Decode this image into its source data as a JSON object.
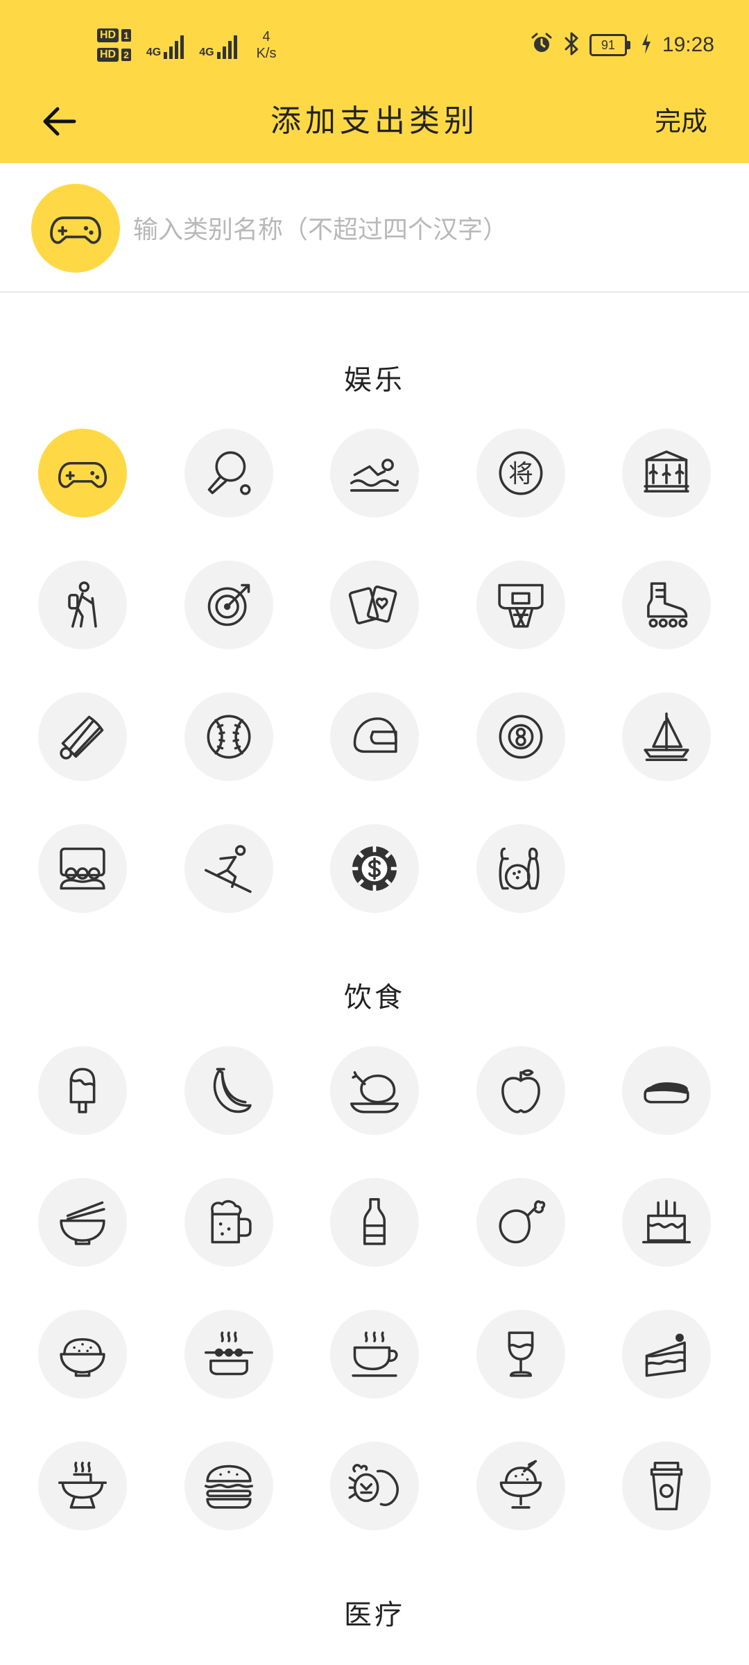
{
  "status_bar": {
    "sim1_badge": "HD",
    "sim1_slot": "1",
    "sim2_badge": "HD",
    "sim2_slot": "2",
    "net1": "4G",
    "net2": "4G",
    "speed_value": "4",
    "speed_unit": "K/s",
    "battery": "91",
    "time": "19:28"
  },
  "header": {
    "title": "添加支出类别",
    "done": "完成"
  },
  "input": {
    "placeholder": "输入类别名称（不超过四个汉字）",
    "value": "",
    "selected_icon": "gamepad-icon"
  },
  "sections": [
    {
      "title": "娱乐",
      "icons": [
        "gamepad-icon",
        "ping-pong-icon",
        "swimming-icon",
        "chess-piece-icon",
        "carousel-icon",
        "hiking-icon",
        "target-icon",
        "playing-cards-icon",
        "basketball-hoop-icon",
        "roller-skate-icon",
        "shuttlecock-icon",
        "baseball-icon",
        "helmet-icon",
        "billiard-ball-icon",
        "sailboat-icon",
        "cinema-icon",
        "skiing-icon",
        "poker-chip-icon",
        "bowling-icon"
      ],
      "chess_glyph": "将"
    },
    {
      "title": "饮食",
      "icons": [
        "popsicle-icon",
        "banana-icon",
        "roast-chicken-icon",
        "apple-icon",
        "sushi-icon",
        "noodle-bowl-icon",
        "beer-mug-icon",
        "bottle-icon",
        "drumstick-icon",
        "birthday-cake-icon",
        "rice-bowl-icon",
        "skewer-icon",
        "coffee-cup-icon",
        "wine-glass-icon",
        "cake-slice-icon",
        "hot-pot-icon",
        "hamburger-icon",
        "seafood-icon",
        "ice-cream-sundae-icon",
        "takeaway-cup-icon"
      ]
    },
    {
      "title": "医疗",
      "icons": []
    }
  ],
  "colors": {
    "accent": "#FFD945",
    "icon_bg": "#f2f2f2",
    "icon_stroke": "#333333",
    "placeholder": "#b8b8b8"
  }
}
